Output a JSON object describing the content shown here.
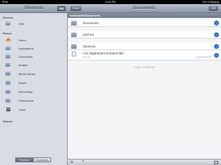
{
  "statusbar": {
    "carrier": "iPad",
    "time": "6:18 PM",
    "battery": "Not Charging"
  },
  "sidebar": {
    "title": "Shortcuts",
    "edit_label": "Edit",
    "sections": {
      "devices": "Devices",
      "places": "Places",
      "shared": "Shared"
    },
    "devices": [
      {
        "label": "Disk",
        "icon": "disk-icon"
      }
    ],
    "places": [
      {
        "label": "Home",
        "icon": "home-icon"
      },
      {
        "label": "Applications",
        "icon": "folder-icon"
      },
      {
        "label": "Documents",
        "icon": "folder-icon"
      },
      {
        "label": "Images",
        "icon": "folder-icon"
      },
      {
        "label": "Media Library",
        "icon": "folder-icon"
      },
      {
        "label": "Books",
        "icon": "folder-icon"
      },
      {
        "label": "Recordings",
        "icon": "folder-icon"
      },
      {
        "label": "Preferences",
        "icon": "folder-icon"
      },
      {
        "label": "Trash",
        "icon": "trash-icon"
      }
    ],
    "tabs": [
      {
        "label": "Shortcuts",
        "active": true
      },
      {
        "label": "Bookmarks",
        "active": false
      }
    ]
  },
  "main": {
    "back_label": "Folder",
    "title": "Documents",
    "edit_label": "Edit",
    "path": "/var/mobile/Documents",
    "files": [
      {
        "name": "Documents",
        "type": "folder"
      },
      {
        "name": "iAPFree",
        "type": "folder"
      },
      {
        "name": "Zeusmos",
        "type": "folder"
      }
    ],
    "deb_file": {
      "name": "com.iapphacks.ironman3.deb",
      "size": "26.4 KB",
      "date": "6/1/13, 6:38 PM"
    },
    "summary": "4 Files, 1.4 GB free"
  },
  "colors": {
    "accent": "#2f6fd6",
    "header": "#8d98a7"
  }
}
